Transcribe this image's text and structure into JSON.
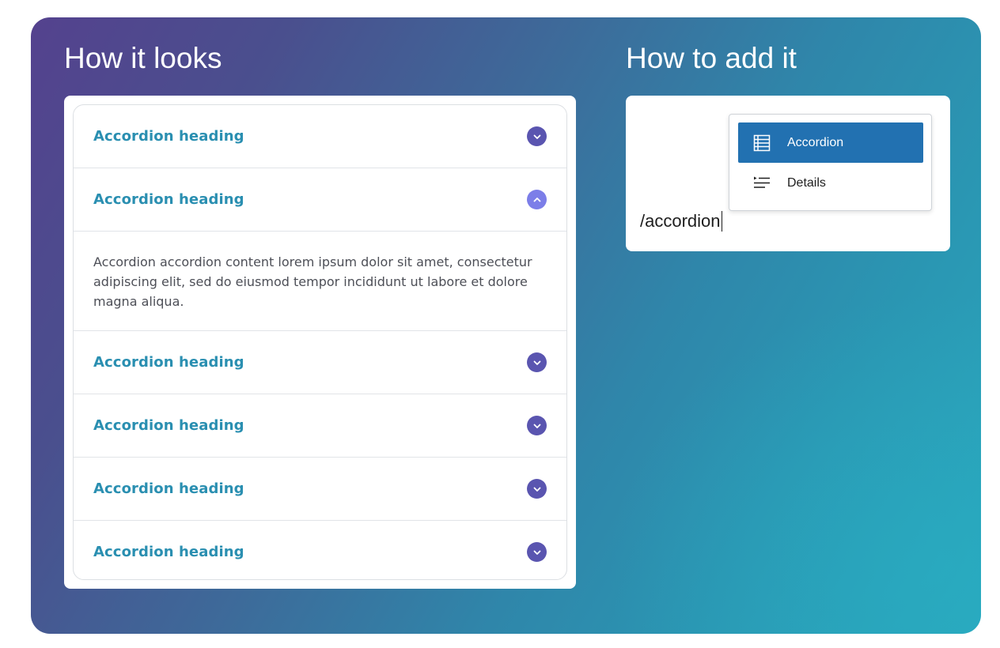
{
  "left_section": {
    "title": "How it looks",
    "accordion": {
      "items": [
        {
          "heading": "Accordion heading",
          "expanded": false
        },
        {
          "heading": "Accordion heading",
          "expanded": true,
          "content": "Accordion accordion content lorem ipsum dolor sit amet, consectetur adipiscing elit, sed do eiusmod tempor incididunt ut labore et dolore magna aliqua."
        },
        {
          "heading": "Accordion heading",
          "expanded": false
        },
        {
          "heading": "Accordion heading",
          "expanded": false
        },
        {
          "heading": "Accordion heading",
          "expanded": false
        },
        {
          "heading": "Accordion heading",
          "expanded": false
        }
      ]
    }
  },
  "right_section": {
    "title": "How to add it",
    "editor": {
      "input_value": "/accordion"
    },
    "dropdown": {
      "items": [
        {
          "label": "Accordion",
          "icon": "table-list-icon",
          "selected": true
        },
        {
          "label": "Details",
          "icon": "details-list-icon",
          "selected": false
        }
      ]
    }
  },
  "colors": {
    "heading": "#2a8fb1",
    "toggle": "#5a55b0",
    "toggle_open": "#7c7ee8",
    "selected_item": "#2271b1"
  }
}
